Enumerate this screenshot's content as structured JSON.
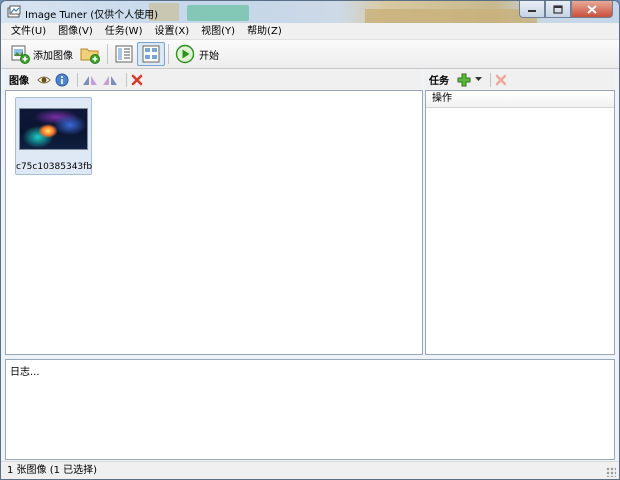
{
  "window": {
    "title": "Image Tuner (仅供个人使用)",
    "icon": "app-icon",
    "controls": [
      "minimize-icon",
      "maximize-icon",
      "close-icon"
    ]
  },
  "menu": [
    "文件(U)",
    "图像(V)",
    "任务(W)",
    "设置(X)",
    "视图(Y)",
    "帮助(Z)"
  ],
  "toolbar": {
    "add_images": "添加图像",
    "add_folder_icon": "folder-add-icon",
    "details_view_icon": "details-view-icon",
    "thumbnail_view_icon": "thumbnail-view-icon",
    "start": "开始"
  },
  "images_panel": {
    "label": "图像",
    "icons": [
      "eye-icon",
      "info-icon",
      "flip-horizontal-icon",
      "flip-vertical-icon",
      "delete-icon"
    ],
    "items": [
      {
        "name": "c75c10385343fb..."
      }
    ]
  },
  "tasks_panel": {
    "label": "任务",
    "icons": [
      "add-task-icon",
      "dropdown-arrow-icon",
      "remove-task-icon"
    ],
    "column": "操作"
  },
  "log": {
    "text": "日志..."
  },
  "status": {
    "text": "1 张图像 (1 已选择)"
  },
  "colors": {
    "accent": "#7da2ce",
    "add_green": "#3aa52a",
    "delete_red": "#d83a2a",
    "play_green": "#2f8f1f"
  }
}
